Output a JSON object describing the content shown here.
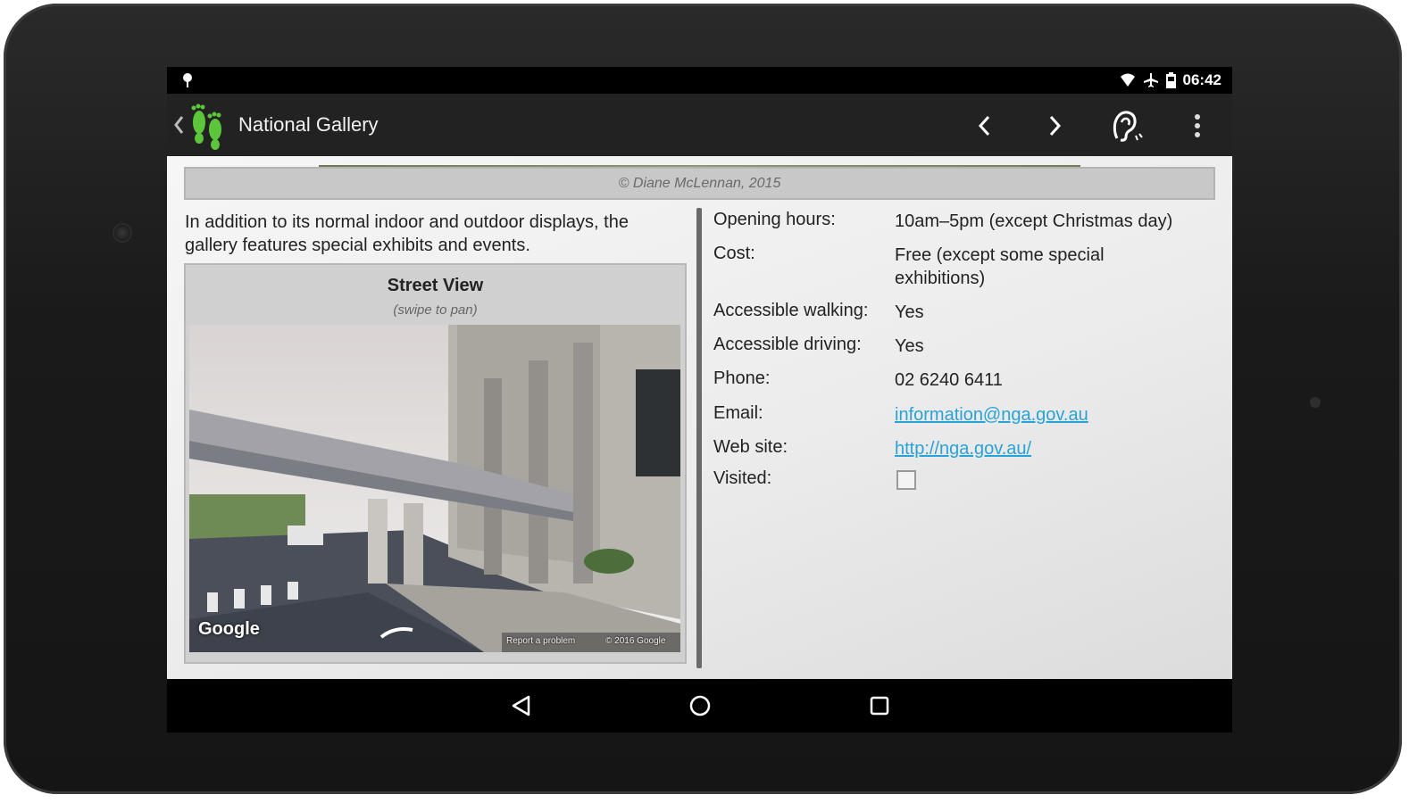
{
  "status_bar": {
    "time": "06:42"
  },
  "action_bar": {
    "title": "National Gallery"
  },
  "photo": {
    "credit": "© Diane McLennan, 2015"
  },
  "description": "In addition to its normal indoor and outdoor displays, the gallery features special exhibits and events.",
  "street_view": {
    "title": "Street View",
    "subtitle": "(swipe to pan)",
    "brand": "Google",
    "report_label": "Report a problem",
    "copyright": "© 2016 Google"
  },
  "details": {
    "opening_hours": {
      "label": "Opening hours:",
      "value": "10am–5pm (except Christmas day)"
    },
    "cost": {
      "label": "Cost:",
      "value": "Free (except some special exhibitions)"
    },
    "accessible_walking": {
      "label": "Accessible walking:",
      "value": "Yes"
    },
    "accessible_driving": {
      "label": "Accessible driving:",
      "value": "Yes"
    },
    "phone": {
      "label": "Phone:",
      "value": "02 6240 6411"
    },
    "email": {
      "label": "Email:",
      "value": "information@nga.gov.au"
    },
    "website": {
      "label": "Web site:",
      "value": "http://nga.gov.au/"
    },
    "visited": {
      "label": "Visited:",
      "checked": false
    }
  },
  "icons": {
    "status_left": "location-pin-icon",
    "status_right": [
      "wifi-icon",
      "airplane-icon",
      "battery-icon"
    ],
    "action_bar": [
      "back-chevron-icon",
      "app-footprints-icon",
      "previous-icon",
      "next-icon",
      "audio-guide-icon",
      "overflow-menu-icon"
    ],
    "nav_bar": [
      "back-icon",
      "home-icon",
      "recents-icon"
    ]
  },
  "colors": {
    "link": "#29a3d6",
    "logo_green": "#5cc53a",
    "action_bar": "#222222"
  }
}
